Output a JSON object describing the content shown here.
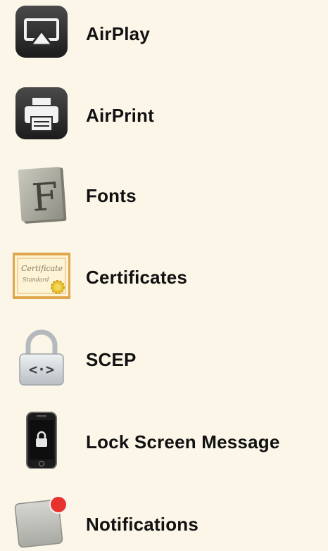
{
  "payloads": [
    {
      "label": "AirPlay",
      "icon": "airplay-icon"
    },
    {
      "label": "AirPrint",
      "icon": "airprint-icon"
    },
    {
      "label": "Fonts",
      "icon": "fonts-icon"
    },
    {
      "label": "Certificates",
      "icon": "certificate-icon"
    },
    {
      "label": "SCEP",
      "icon": "scep-lock-icon"
    },
    {
      "label": "Lock Screen Message",
      "icon": "lock-screen-phone-icon"
    },
    {
      "label": "Notifications",
      "icon": "notifications-icon"
    }
  ],
  "colors": {
    "background": "#fbf6e8",
    "label_text": "#111111",
    "notification_badge": "#e8322d",
    "certificate_border": "#e0a64a"
  }
}
